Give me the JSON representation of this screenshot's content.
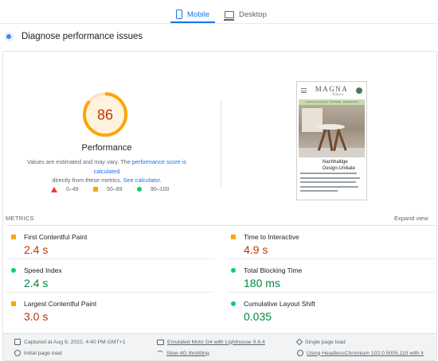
{
  "tabs": {
    "mobile": "Mobile",
    "desktop": "Desktop",
    "active": "Mobile",
    "accent_color": "#1a73e8"
  },
  "diagnose": {
    "title": "Diagnose performance issues",
    "icon": "lighthouse-pulse-icon"
  },
  "summary": {
    "score": 86,
    "score_color": "#c33300",
    "gauge_color": "#ffa400",
    "label": "Performance",
    "note_prefix": "Values are estimated and may vary. The ",
    "note_link1": "performance score is calculated",
    "note_middle": " directly from these metrics. ",
    "note_link2": "See calculator."
  },
  "legend": [
    {
      "range": "0–49",
      "shape": "triangle",
      "color": "#e53935"
    },
    {
      "range": "50–89",
      "shape": "square",
      "color": "#ffa400"
    },
    {
      "range": "90–100",
      "shape": "circle",
      "color": "#0cce6b"
    }
  ],
  "preview": {
    "logo": "MAGNA",
    "logo_sub": "Natura",
    "banner": "Kostenloser Versand · Nachhaltig · Handgemacht",
    "heading_line1": "Nachhaltige",
    "heading_line2": "Design-Unikate"
  },
  "metrics": {
    "header": "METRICS",
    "expand": "Expand view",
    "items": [
      {
        "name": "First Contentful Paint",
        "value": "2.4 s",
        "status": "orange"
      },
      {
        "name": "Time to Interactive",
        "value": "4.9 s",
        "status": "orange"
      },
      {
        "name": "Speed Index",
        "value": "2.4 s",
        "status": "green"
      },
      {
        "name": "Total Blocking Time",
        "value": "180 ms",
        "status": "green"
      },
      {
        "name": "Largest Contentful Paint",
        "value": "3.0 s",
        "status": "orange"
      },
      {
        "name": "Cumulative Layout Shift",
        "value": "0.035",
        "status": "green"
      }
    ]
  },
  "footer": {
    "captured": "Captured at Aug 9, 2022, 4:40 PM GMT+1",
    "initial_load": "Initial page load",
    "emulated": "Emulated Moto G4 with Lighthouse 9.6.4",
    "throttling": "Slow 4G throttling",
    "single_load": "Single page load",
    "browser": "Using HeadlessChromium 102.0.5005.115 with lr"
  }
}
